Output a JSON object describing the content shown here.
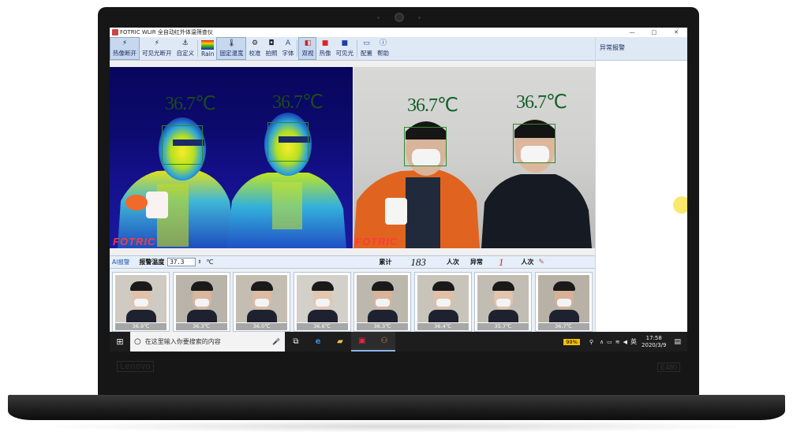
{
  "window": {
    "title": "FOTRIC WLIR 全自动红外体温筛查仪",
    "controls": [
      "—",
      "□",
      "✕"
    ]
  },
  "toolbar": {
    "buttons": [
      {
        "label": "热像断开",
        "icon": "disconnect-icon",
        "glyph": "⚡"
      },
      {
        "label": "可见光断开",
        "icon": "disconnect-icon",
        "glyph": "⚡"
      },
      {
        "label": "自定义",
        "icon": "anchor-icon",
        "glyph": "⚓"
      },
      {
        "label": "Rain",
        "icon": "palette-icon",
        "glyph": "▬"
      },
      {
        "label": "固定温宽",
        "icon": "thermometer-icon",
        "glyph": "🌡"
      },
      {
        "label": "校准",
        "icon": "gear-icon",
        "glyph": "⚙"
      },
      {
        "label": "拍照",
        "icon": "camera-icon",
        "glyph": "◘"
      },
      {
        "label": "字体",
        "icon": "font-icon",
        "glyph": "A"
      },
      {
        "label": "双视",
        "icon": "dual-view-icon",
        "glyph": "◧"
      },
      {
        "label": "热像",
        "icon": "thermal-view-icon",
        "glyph": "■"
      },
      {
        "label": "可见光",
        "icon": "visible-view-icon",
        "glyph": "■"
      },
      {
        "label": "配置",
        "icon": "monitor-icon",
        "glyph": "▭"
      },
      {
        "label": "帮助",
        "icon": "info-icon",
        "glyph": "ⓘ"
      }
    ]
  },
  "alarm_panel": {
    "title": "异常报警"
  },
  "video": {
    "thermal_temps": [
      "36.7℃",
      "36.7℃"
    ],
    "visible_temps": [
      "36.7℃",
      "36.7℃"
    ],
    "watermark": "FOTRIC"
  },
  "status": {
    "ai_label": "AI报警",
    "threshold_label": "报警温度",
    "threshold_value": "37.3",
    "unit": "℃",
    "total_label": "累计",
    "total_value": "183",
    "total_unit": "人次",
    "abnormal_label": "异常",
    "abnormal_value": "1",
    "abnormal_unit": "人次"
  },
  "thumbnails": [
    "36.9℃",
    "36.3℃",
    "36.0℃",
    "36.6℃",
    "36.3℃",
    "36.4℃",
    "35.7℃",
    "36.7℃"
  ],
  "taskbar": {
    "search_placeholder": "在这里输入你要搜索的内容",
    "battery": "99%",
    "ime": "英",
    "time": "17:58",
    "date": "2020/3/9"
  },
  "laptop": {
    "brand": "Lenovo",
    "model": "E480"
  },
  "colors": {
    "toolbar_bg": "#dfe9f5",
    "temp_green": "#14602a",
    "watermark_red": "#ff3a3a",
    "taskbar_bg": "#1d1d1d"
  }
}
